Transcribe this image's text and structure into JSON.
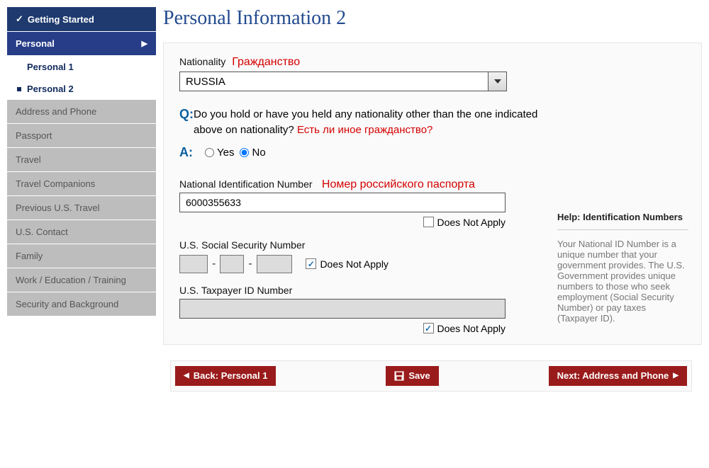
{
  "page": {
    "title": "Personal Information 2"
  },
  "sidebar": {
    "getting_started": "Getting Started",
    "personal": "Personal",
    "personal1": "Personal 1",
    "personal2": "Personal 2",
    "items": [
      "Address and Phone",
      "Passport",
      "Travel",
      "Travel Companions",
      "Previous U.S. Travel",
      "U.S. Contact",
      "Family",
      "Work / Education / Training",
      "Security and Background"
    ]
  },
  "form": {
    "nationality_label": "Nationality",
    "nationality_hint": "Гражданство",
    "nationality_value": "RUSSIA",
    "question": "Do you hold or have you held any nationality other than the one indicated above on nationality?",
    "question_hint": "Есть ли иное гражданство?",
    "yes": "Yes",
    "no": "No",
    "answer": "No",
    "nin_label": "National Identification Number",
    "nin_hint": "Номер российского паспорта",
    "nin_value": "6000355633",
    "does_not_apply": "Does Not Apply",
    "ssn_label": "U.S. Social Security Number",
    "tax_label": "U.S. Taxpayer ID Number"
  },
  "help": {
    "title_prefix": "Help:",
    "title": "Identification Numbers",
    "body": "Your National ID Number is a unique number that your government provides. The U.S. Government provides unique numbers to those who seek employment (Social Security Number) or pay taxes (Taxpayer ID)."
  },
  "buttons": {
    "back": "Back: Personal 1",
    "save": "Save",
    "next": "Next: Address and Phone"
  }
}
